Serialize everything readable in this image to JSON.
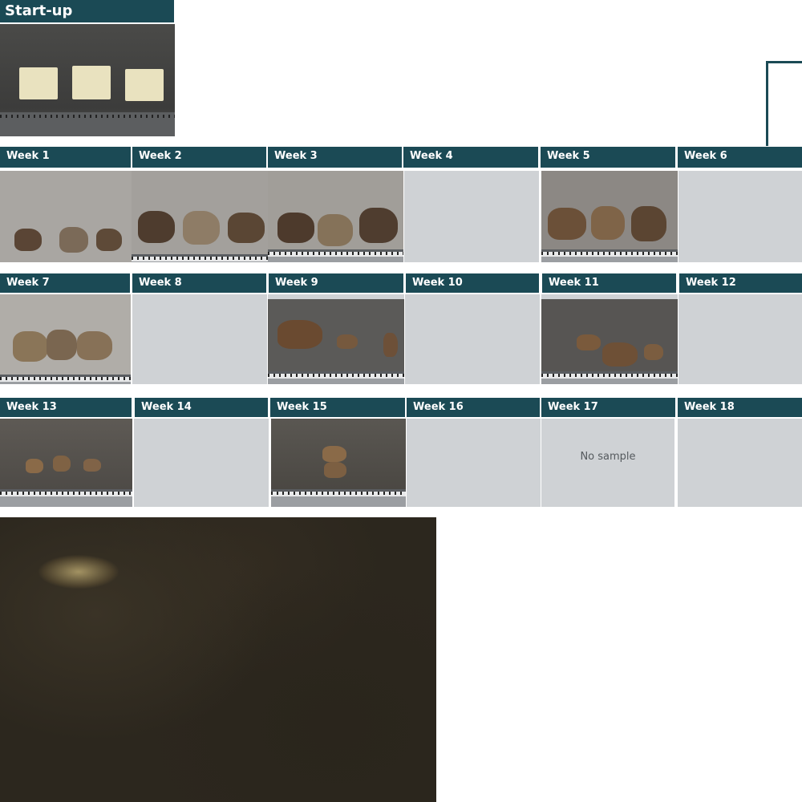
{
  "startup": {
    "label": "Start-up"
  },
  "weeks": [
    {
      "label": "Week 1"
    },
    {
      "label": "Week 2"
    },
    {
      "label": "Week 3"
    },
    {
      "label": "Week 4"
    },
    {
      "label": "Week 5"
    },
    {
      "label": "Week 6"
    },
    {
      "label": "Week 7"
    },
    {
      "label": "Week 8"
    },
    {
      "label": "Week 9"
    },
    {
      "label": "Week 10"
    },
    {
      "label": "Week 11"
    },
    {
      "label": "Week 12"
    },
    {
      "label": "Week 13"
    },
    {
      "label": "Week 14"
    },
    {
      "label": "Week 15"
    },
    {
      "label": "Week 16"
    },
    {
      "label": "Week 17",
      "note": "No sample"
    },
    {
      "label": "Week 18"
    }
  ],
  "colors": {
    "header": "#1b4a55",
    "empty_panel": "#cfd2d5"
  }
}
